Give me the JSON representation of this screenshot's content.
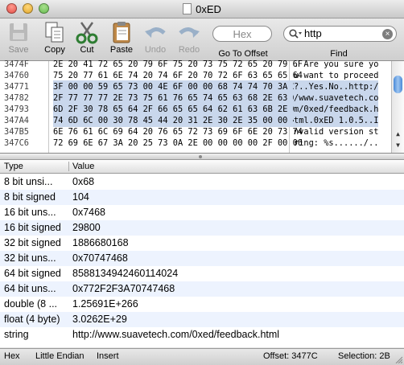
{
  "window": {
    "title": "0xED"
  },
  "toolbar": {
    "save": "Save",
    "copy": "Copy",
    "cut": "Cut",
    "paste": "Paste",
    "undo": "Undo",
    "redo": "Redo",
    "goto_label": "Go To Offset",
    "goto_placeholder": "Hex",
    "find_label": "Find",
    "find_value": "http"
  },
  "hex_rows": [
    {
      "offset": "3474F",
      "bytes": "2E 20 41 72 65 20 79 6F 75 20 73 75 72 65 20 79 6F",
      "ascii": ". Are you sure yo"
    },
    {
      "offset": "34760",
      "bytes": "75 20 77 61 6E 74 20 74 6F 20 70 72 6F 63 65 65 64",
      "ascii": "u want to proceed"
    },
    {
      "offset": "34771",
      "bytes": "3F 00 00 59 65 73 00 4E 6F 00 00 68 74 74 70 3A 2F",
      "ascii": "?..Yes.No..http:/"
    },
    {
      "offset": "34782",
      "bytes": "2F 77 77 77 2E 73 75 61 76 65 74 65 63 68 2E 63 6F",
      "ascii": "/www.suavetech.co"
    },
    {
      "offset": "34793",
      "bytes": "6D 2F 30 78 65 64 2F 66 65 65 64 62 61 63 6B 2E 68",
      "ascii": "m/0xed/feedback.h"
    },
    {
      "offset": "347A4",
      "bytes": "74 6D 6C 00 30 78 45 44 20 31 2E 30 2E 35 00 00 49",
      "ascii": "tml.0xED 1.0.5..I"
    },
    {
      "offset": "347B5",
      "bytes": "6E 76 61 6C 69 64 20 76 65 72 73 69 6F 6E 20 73 74",
      "ascii": "nvalid version st"
    },
    {
      "offset": "347C6",
      "bytes": "72 69 6E 67 3A 20 25 73 0A 2E 00 00 00 00 2F 00 00",
      "ascii": "ring: %s....../.."
    }
  ],
  "table": {
    "col_type": "Type",
    "col_value": "Value",
    "rows": [
      {
        "type": "8 bit unsi...",
        "value": "0x68"
      },
      {
        "type": "8 bit signed",
        "value": "104"
      },
      {
        "type": "16 bit uns...",
        "value": "0x7468"
      },
      {
        "type": "16 bit signed",
        "value": "29800"
      },
      {
        "type": "32 bit signed",
        "value": "1886680168"
      },
      {
        "type": "32 bit uns...",
        "value": "0x70747468"
      },
      {
        "type": "64 bit signed",
        "value": "8588134942460114024"
      },
      {
        "type": "64 bit uns...",
        "value": "0x772F2F3A70747468"
      },
      {
        "type": "double (8 ...",
        "value": "1.25691E+266"
      },
      {
        "type": "float (4 byte)",
        "value": "3.0262E+29"
      },
      {
        "type": "string",
        "value": "http://www.suavetech.com/0xed/feedback.html"
      }
    ]
  },
  "status": {
    "mode": "Hex",
    "endian": "Little Endian",
    "insert": "Insert",
    "offset": "Offset: 3477C",
    "selection": "Selection: 2B"
  },
  "colors": {
    "selection": "#c9d7ec",
    "alt_row": "#edf3fe",
    "close": "#e0443e",
    "minimize": "#dea123",
    "zoom": "#5fb74a"
  }
}
